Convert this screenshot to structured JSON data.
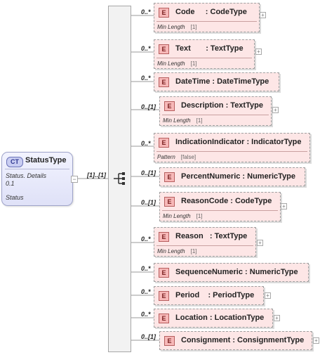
{
  "complex_type": {
    "badge": "CT",
    "name": "StatusType",
    "doc_line1": "Status. Details",
    "doc_line2": "0.1",
    "doc_line3": "Status",
    "collapse_symbol": "−"
  },
  "sequence": {
    "multiplicity": "[1]..[1]",
    "icon": "sequence-compositor-icon"
  },
  "expand_symbol": "+",
  "element_badge": "E",
  "elements": [
    {
      "name": "Code     : CodeType",
      "mult": "0..*",
      "facet_key": "Min Length",
      "facet_val": "[1]"
    },
    {
      "name": "Text       : TextType",
      "mult": "0..*",
      "facet_key": "Min Length",
      "facet_val": "[1]"
    },
    {
      "name": "DateTime : DateTimeType",
      "mult": "0..*"
    },
    {
      "name": "Description : TextType",
      "mult": "0..[1]",
      "facet_key": "Min Length",
      "facet_val": "[1]"
    },
    {
      "name": "IndicationIndicator : IndicatorType",
      "mult": "0..*",
      "facet_key": "Pattern",
      "facet_val": "[false]"
    },
    {
      "name": "PercentNumeric : NumericType",
      "mult": "0..[1]"
    },
    {
      "name": "ReasonCode : CodeType",
      "mult": "0..[1]",
      "facet_key": "Min Length",
      "facet_val": "[1]"
    },
    {
      "name": "Reason   : TextType",
      "mult": "0..*",
      "facet_key": "Min Length",
      "facet_val": "[1]"
    },
    {
      "name": "SequenceNumeric : NumericType",
      "mult": "0..*"
    },
    {
      "name": "Period    : PeriodType",
      "mult": "0..*"
    },
    {
      "name": "Location : LocationType",
      "mult": "0..*"
    },
    {
      "name": "Consignment : ConsignmentType",
      "mult": "0..[1]"
    }
  ]
}
